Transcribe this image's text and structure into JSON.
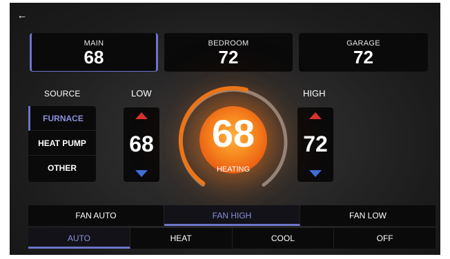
{
  "nav": {
    "back_icon": "arrow-left-icon"
  },
  "zones": [
    {
      "name": "MAIN",
      "temp": "68",
      "selected": true
    },
    {
      "name": "BEDROOM",
      "temp": "72",
      "selected": false
    },
    {
      "name": "GARAGE",
      "temp": "72",
      "selected": false
    }
  ],
  "source": {
    "title": "SOURCE",
    "items": [
      {
        "label": "FURNACE",
        "active": true
      },
      {
        "label": "HEAT PUMP",
        "active": false
      },
      {
        "label": "OTHER",
        "active": false
      }
    ]
  },
  "setpoints": {
    "low": {
      "label": "LOW",
      "value": "68"
    },
    "high": {
      "label": "HIGH",
      "value": "72"
    }
  },
  "dial": {
    "temperature": "68",
    "status": "HEATING",
    "arc_fill_fraction": 0.55
  },
  "fan": {
    "items": [
      {
        "label": "FAN AUTO",
        "active": false
      },
      {
        "label": "FAN HIGH",
        "active": true
      },
      {
        "label": "FAN LOW",
        "active": false
      }
    ]
  },
  "mode": {
    "items": [
      {
        "label": "AUTO",
        "active": true
      },
      {
        "label": "HEAT",
        "active": false
      },
      {
        "label": "COOL",
        "active": false
      },
      {
        "label": "OFF",
        "active": false
      }
    ]
  },
  "colors": {
    "accent": "#6e74c9",
    "accent_text": "#8c90dd",
    "heat": "#f07a1c",
    "arrow_up": "#d8322c",
    "arrow_down": "#3d6fd9"
  }
}
